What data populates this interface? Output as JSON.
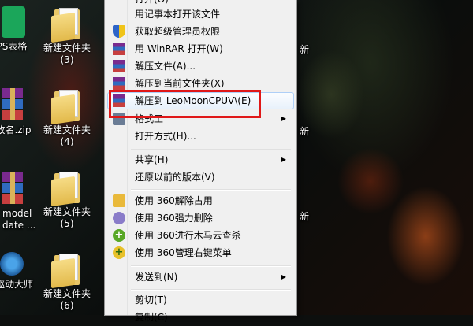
{
  "desktop": {
    "icons": [
      {
        "label": "PS表格",
        "type": "app"
      },
      {
        "label": "新建文件夹\n(3)",
        "type": "folder"
      },
      {
        "label": "改名.zip",
        "type": "rar"
      },
      {
        "label": "新建文件夹\n(4)",
        "type": "folder"
      },
      {
        "label": "model\ndate ...",
        "type": "rar"
      },
      {
        "label": "新建文件夹\n(5)",
        "type": "folder"
      },
      {
        "label": "驱动大师",
        "type": "app"
      },
      {
        "label": "新建文件夹\n(6)",
        "type": "folder"
      }
    ],
    "right_edge_text": [
      "新",
      "新",
      "新"
    ]
  },
  "menu": {
    "items": [
      {
        "label": "打开(O)",
        "icon": "none"
      },
      {
        "label": "用记事本打开该文件",
        "icon": "none"
      },
      {
        "label": "获取超级管理员权限",
        "icon": "shield-icon"
      },
      {
        "label": "用 WinRAR 打开(W)",
        "icon": "winrar-icon"
      },
      {
        "label": "解压文件(A)...",
        "icon": "winrar-icon"
      },
      {
        "label": "解压到当前文件夹(X)",
        "icon": "winrar-icon"
      },
      {
        "label": "解压到 LeoMoonCPUV\\(E)",
        "icon": "winrar-icon"
      },
      {
        "label": "格式工",
        "icon": "format-icon",
        "submenu": "▶"
      },
      {
        "label": "打开方式(H)...",
        "icon": "none"
      },
      {
        "label": "共享(H)",
        "icon": "none",
        "submenu": "▶"
      },
      {
        "label": "还原以前的版本(V)",
        "icon": "none"
      },
      {
        "label": "使用 360解除占用",
        "icon": "360-unlock-icon"
      },
      {
        "label": "使用 360强力删除",
        "icon": "360-delete-icon"
      },
      {
        "label": "使用 360进行木马云查杀",
        "icon": "360-scan-icon"
      },
      {
        "label": "使用 360管理右键菜单",
        "icon": "360-manage-icon"
      },
      {
        "label": "发送到(N)",
        "icon": "none",
        "submenu": "▶"
      },
      {
        "label": "剪切(T)",
        "icon": "none"
      },
      {
        "label": "复制(C)",
        "icon": "none"
      }
    ],
    "highlight_color": "#e01818"
  }
}
